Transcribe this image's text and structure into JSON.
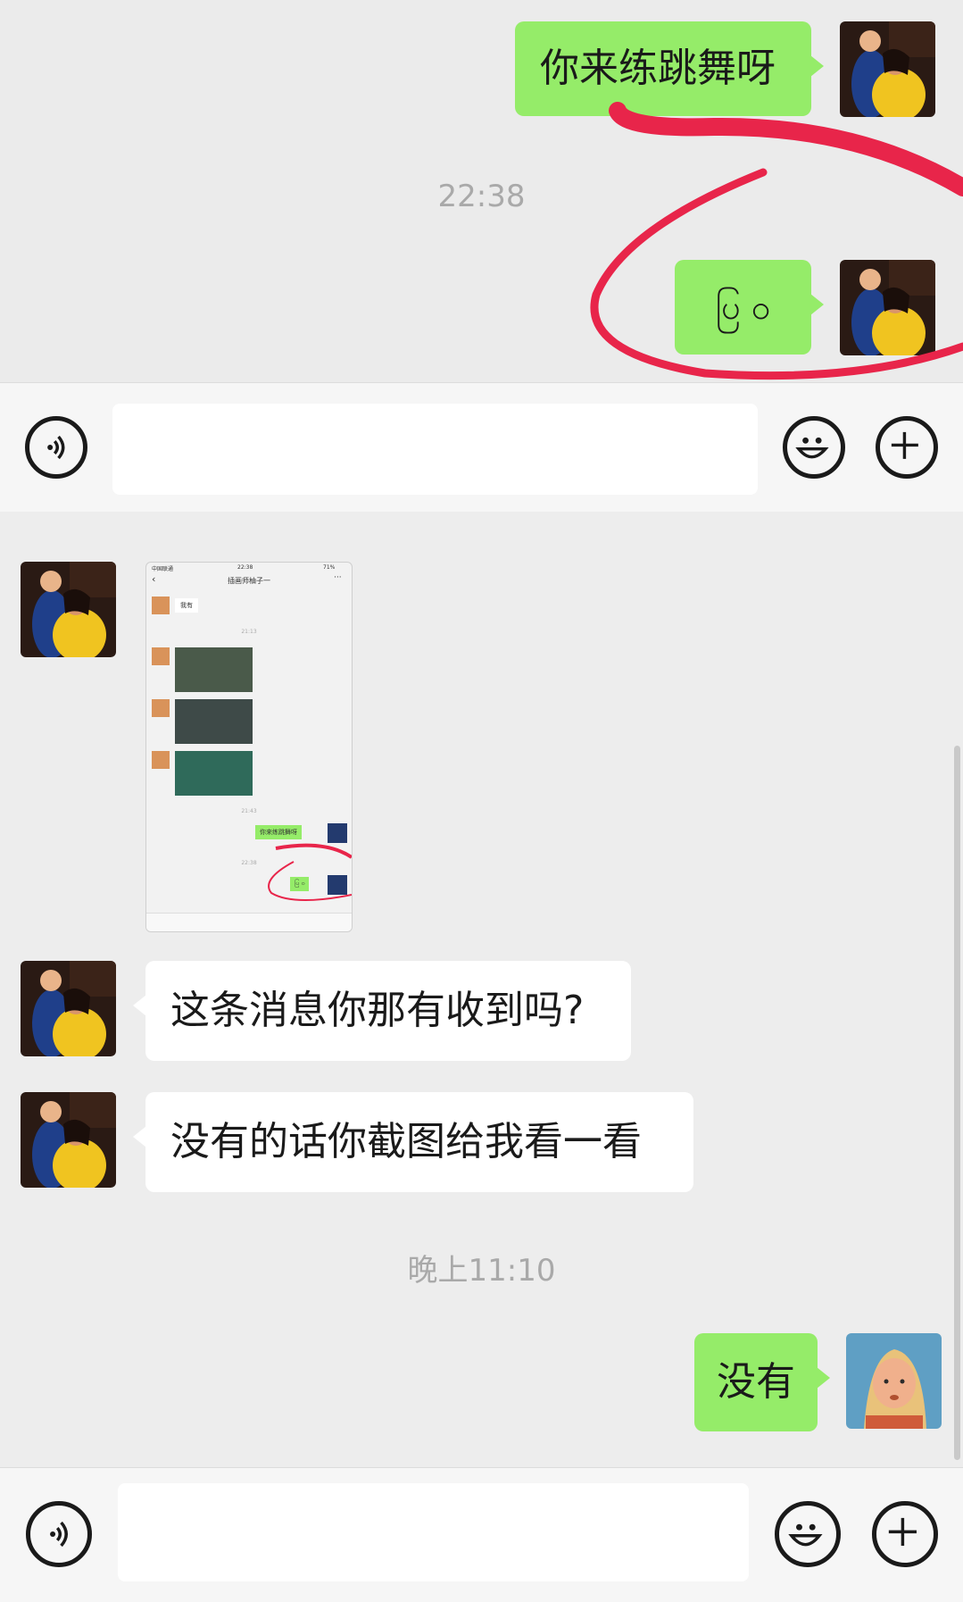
{
  "top_chat": {
    "message1": "你来练跳舞呀",
    "timestamp": "22:38",
    "message2": "ပြ ဝ"
  },
  "screenshot_image": {
    "status_carrier": "中国联通",
    "status_time": "22:38",
    "status_battery": "71%",
    "title": "插画师柚子一",
    "msg_reply": "我有",
    "ts1": "21:13",
    "ts2": "21:43",
    "msg_dance": "你来练跳舞呀",
    "ts3": "22:38",
    "msg_symbol": "ပြ ဝ"
  },
  "bottom_chat": {
    "message_q": "这条消息你那有收到吗?",
    "message_s": "没有的话你截图给我看一看",
    "timestamp": "晚上11:10",
    "message_reply": "没有"
  },
  "icons": {
    "voice": "voice-icon",
    "emoji": "emoji-icon",
    "plus": "plus-icon"
  },
  "colors": {
    "green_bubble": "#95ec69",
    "white_bubble": "#ffffff",
    "background": "#ededed",
    "annotation": "#e8254a"
  }
}
